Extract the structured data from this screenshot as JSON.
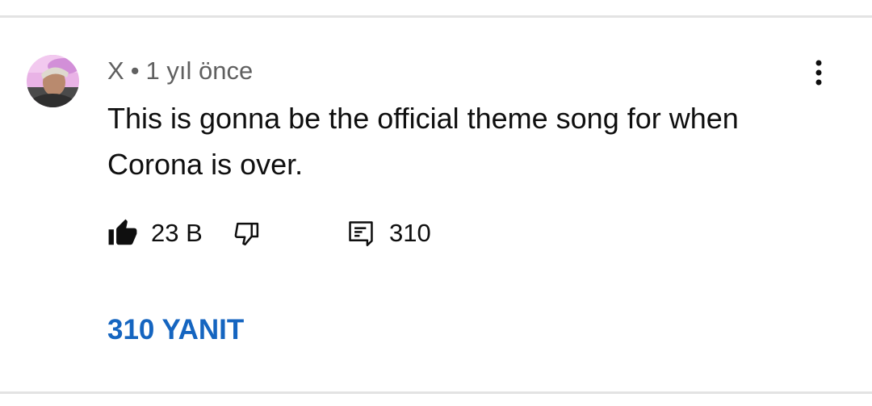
{
  "comment": {
    "author": "X",
    "separator": "•",
    "time": "1 yıl önce",
    "text": "This is gonna be the official theme song for when Corona is over."
  },
  "actions": {
    "like_count": "23 B",
    "reply_count": "310"
  },
  "replies": {
    "label": "310 YANIT"
  },
  "icons": {
    "like": "thumbs-up-icon",
    "dislike": "thumbs-down-icon",
    "reply": "comment-icon",
    "menu": "more-vertical-icon"
  },
  "colors": {
    "link": "#1565c0",
    "meta_text": "#606060",
    "text": "#0f0f0f",
    "divider": "#e3e3e3"
  }
}
